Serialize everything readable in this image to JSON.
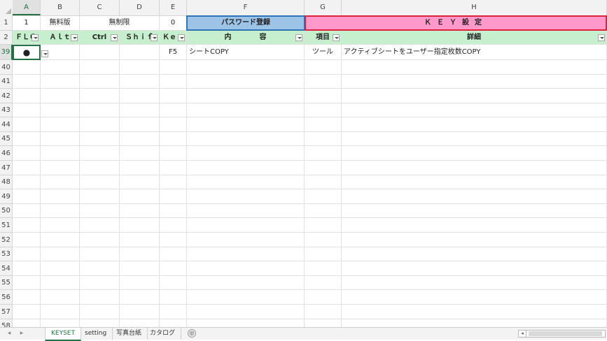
{
  "columns": [
    "A",
    "B",
    "C",
    "D",
    "E",
    "F",
    "G",
    "H"
  ],
  "row_numbers": [
    "1",
    "2",
    "39",
    "40",
    "41",
    "42",
    "43",
    "44",
    "45",
    "46",
    "47",
    "48",
    "49",
    "50",
    "51",
    "52",
    "53",
    "54",
    "55",
    "56",
    "57",
    "58"
  ],
  "row1": {
    "a": "1",
    "b": "無料版",
    "cd": "無制限",
    "e": "0",
    "f": "パスワード登録",
    "gh": "ＫＥＹ設定"
  },
  "row2": {
    "a": "ＦＬＧ",
    "b": "Ａｌｔ",
    "c": "Ctrl",
    "d": "Ｓｈｉｆ",
    "e": "Ｋｅ",
    "f": "内　　　　容",
    "g": "項目",
    "h": "詳細"
  },
  "row39": {
    "a": "●",
    "e": "F5",
    "f": "シートCOPY",
    "g": "ツール",
    "h": "アクティブシートをユーザー指定枚数COPY"
  },
  "sheet_tabs": [
    "KEYSET",
    "setting",
    "写真台紙",
    "カタログ"
  ],
  "add_sheet": "⊕",
  "nav_prev": "◂",
  "nav_next": "▸",
  "scroll_left": "◂",
  "colors": {
    "header_green": "#c6efce",
    "password_blue": "#9dc3e6",
    "key_pink": "#ff99cc",
    "selection_green": "#217346"
  }
}
